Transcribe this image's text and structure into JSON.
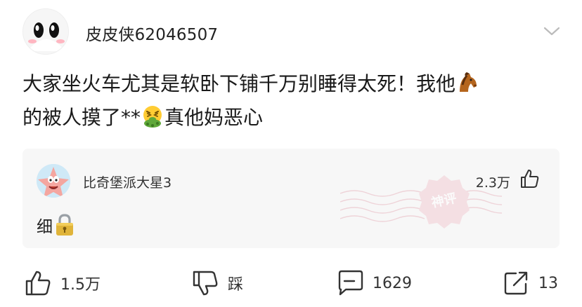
{
  "post": {
    "username": "皮皮侠62046507",
    "text_line1": "大家坐火车尤其是软卧下铺千万别睡得太死！我他",
    "text_line2_a": "的被人摸了**",
    "text_line2_b": "真他妈恶心",
    "icons": [
      "horse-emoji",
      "vomiting-emoji"
    ]
  },
  "comment": {
    "username": "比奇堡派大星3",
    "likes": "2.3万",
    "text": "细",
    "badge": "神评",
    "icons": [
      "lock-emoji",
      "like-icon"
    ]
  },
  "actions": {
    "like_count": "1.5万",
    "dislike_label": "踩",
    "comment_count": "1629",
    "share_count": "13"
  },
  "colors": {
    "background": "#ffffff",
    "comment_bg": "#f7f7f7",
    "text": "#222222",
    "stamp_accent": "#e8a0ad"
  }
}
